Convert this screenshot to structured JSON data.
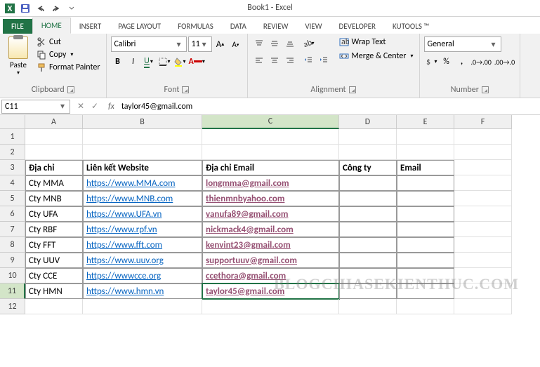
{
  "title": "Book1 - Excel",
  "qat": {
    "items": [
      "save",
      "undo",
      "redo",
      "touch"
    ]
  },
  "tabs": [
    "FILE",
    "HOME",
    "INSERT",
    "PAGE LAYOUT",
    "FORMULAS",
    "DATA",
    "REVIEW",
    "VIEW",
    "DEVELOPER",
    "KUTOOLS ™"
  ],
  "active_tab": 1,
  "ribbon": {
    "clipboard": {
      "paste": "Paste",
      "cut": "Cut",
      "copy": "Copy",
      "painter": "Format Painter",
      "label": "Clipboard"
    },
    "font": {
      "name": "Calibri",
      "size": "11",
      "label": "Font"
    },
    "alignment": {
      "wrap": "Wrap Text",
      "merge": "Merge & Center",
      "label": "Alignment"
    },
    "number": {
      "format": "General",
      "label": "Number"
    }
  },
  "namebox": "C11",
  "formula": "taylor45@gmail.com",
  "columns": [
    "A",
    "B",
    "C",
    "D",
    "E",
    "F"
  ],
  "selected_col": "C",
  "selected_row": 11,
  "headers": {
    "r": 3,
    "A": "Địa chỉ",
    "B": "Liên kết Website",
    "C": "Địa chỉ Email",
    "D": "Công ty",
    "E": "Email"
  },
  "rows": [
    {
      "r": 4,
      "A": "Cty MMA",
      "B": "https://www.MMA.com",
      "C": "longmma@gmail.com"
    },
    {
      "r": 5,
      "A": "Cty MNB",
      "B": "https://www.MNB.com",
      "C": "thienmnbyahoo.com"
    },
    {
      "r": 6,
      "A": "Cty UFA",
      "B": "https://www.UFA.vn",
      "C": "vanufa89@gmail.com"
    },
    {
      "r": 7,
      "A": "Cty RBF",
      "B": "https://www.rpf.vn",
      "C": "nickmack4@gmail.com"
    },
    {
      "r": 8,
      "A": "Cty FFT",
      "B": "https://www.fft.com",
      "C": "kenvint23@gmail.com"
    },
    {
      "r": 9,
      "A": "Cty UUV",
      "B": "https://www.uuv.org",
      "C": "supportuuv@gmail.com"
    },
    {
      "r": 10,
      "A": "Cty CCE",
      "B": "https://wwwcce.org",
      "C": "ccethora@gmail.com"
    },
    {
      "r": 11,
      "A": "Cty HMN",
      "B": "https://www.hmn.vn",
      "C": "taylor45@gmail.com"
    }
  ],
  "watermark": "BLOGCHIASEKIENTHUC.COM"
}
